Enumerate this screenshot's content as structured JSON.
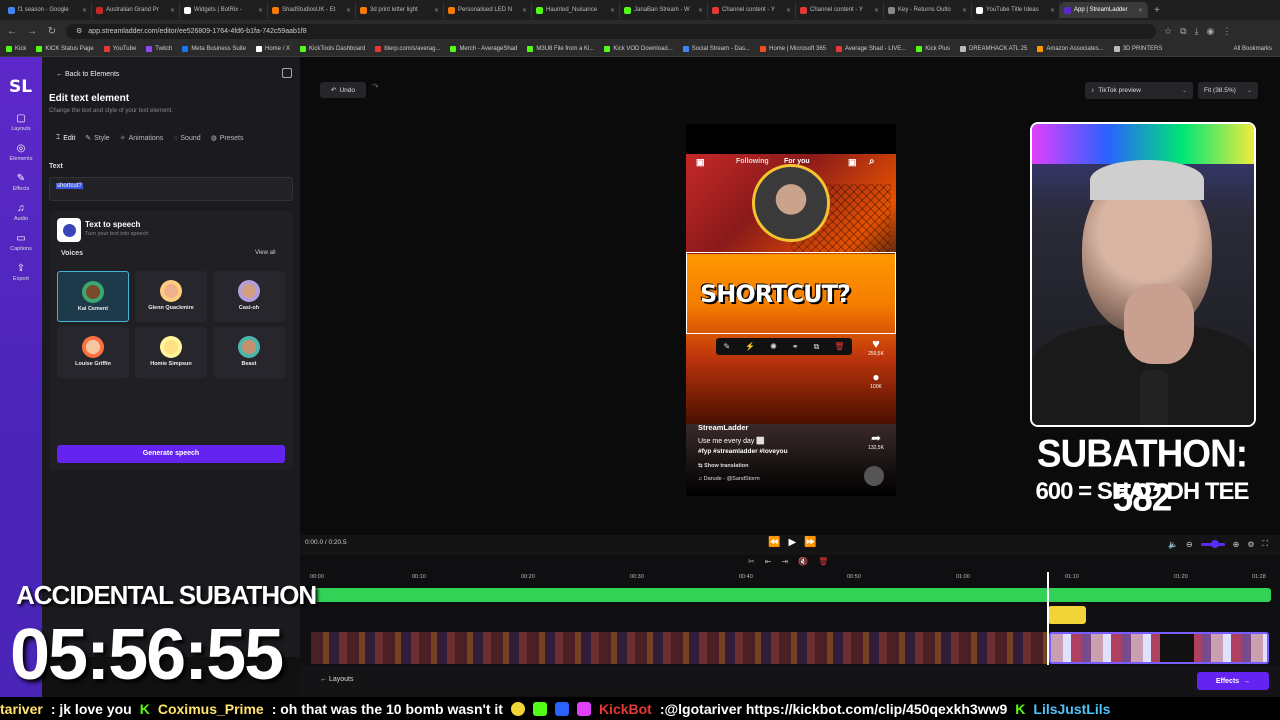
{
  "browser": {
    "tabs": [
      "f1 season - Google",
      "Australian Grand Pr",
      "Widgets | BotRix -",
      "ShadStudiosUK - Et",
      "3d print letter light",
      "Personalised LED N",
      "Haunted_Nuisance",
      "JanaBan Stream - W",
      "Channel content - Y",
      "Channel content - Y",
      "Key - Returns Outlo",
      "YouTube Title Ideas",
      "App | StreamLadder"
    ],
    "tab_colors": [
      "#4285f4",
      "#c62828",
      "#ffffff",
      "#f57c00",
      "#f57c00",
      "#f57c00",
      "#53fc18",
      "#53fc18",
      "#e53935",
      "#e53935",
      "#888888",
      "#ffffff",
      "#5d28c9"
    ],
    "url": "app.streamladder.com/editor/ee526809-1764-4fd6-b1fa-742c59aab1f8",
    "bookmarks": [
      "Kick",
      "KICK Status Page",
      "YouTube",
      "Twitch",
      "Meta Business Suite",
      "Home / X",
      "KickTools Dashboard",
      "blerp.com/s/averag...",
      "Merch - AverageShad",
      "M3U8 File from a Ki...",
      "Kick VOD Download...",
      "Social Stream - Das...",
      "Home | Microsoft 365",
      "Average Shad - LIVE...",
      "Kick Plus",
      "DREAMHACK ATL 25",
      "Amazon Associates...",
      "3D PRINTERS"
    ],
    "all_bookmarks": "All Bookmarks"
  },
  "leftnav": {
    "logo": "SL",
    "items": [
      "Layouts",
      "Elements",
      "Effects",
      "Audio",
      "Captions",
      "Export"
    ]
  },
  "panel": {
    "back": "Back to Elements",
    "title": "Edit text element",
    "subtitle": "Change the text and style of your text element.",
    "tabs": [
      "Edit",
      "Style",
      "Animations",
      "Sound",
      "Presets"
    ],
    "text_label": "Text",
    "text_value": "shortcut?",
    "tts_title": "Text to speech",
    "tts_sub": "Turn your text into speech",
    "voices_label": "Voices",
    "view_all": "View all",
    "voices": [
      "Kai Cement",
      "Glenn Quackmire",
      "Casi-oh",
      "Louise Griffin",
      "Homie Simpsun",
      "Beast"
    ],
    "generate": "Generate speech"
  },
  "toolbar": {
    "undo": "Undo",
    "preview": "TikTok preview",
    "fit": "Fit (38.5%)"
  },
  "phone": {
    "following": "Following",
    "foryou": "For you",
    "headline": "SHORTCUT?",
    "likes": "250,5K",
    "comments": "100K",
    "shares": "132,5K",
    "user": "StreamLadder",
    "caption": "Use me every day ⬜",
    "tags": "#fyp #streamladder #loveyou",
    "translation": "Show translation",
    "sound": "Darude - @SandStorm"
  },
  "overlay": {
    "subathon": "SUBATHON: 582",
    "goal": "600 = SHAD DH TEE",
    "accidental": "ACCIDENTAL SUBATHON",
    "timer": "05:56:55"
  },
  "timeline": {
    "current": "0:00.0",
    "total": "0:20.5",
    "ticks": [
      "00:00",
      "00:10",
      "00:20",
      "00:30",
      "00:40",
      "00:50",
      "01:00",
      "01:10",
      "01:20",
      "01:28"
    ],
    "layouts": "Layouts",
    "effects": "Effects"
  },
  "chat": {
    "m1_user": "tariver",
    "m1_text": ": jk love you",
    "m2_user": "Coximus_Prime",
    "m2_text": ": oh that was the 10 bomb wasn't it",
    "m3_user": "KickBot",
    "m3_text": ":@lgotariver https://kickbot.com/clip/450qexkh3ww9",
    "m4_user": "LilsJustLils"
  }
}
